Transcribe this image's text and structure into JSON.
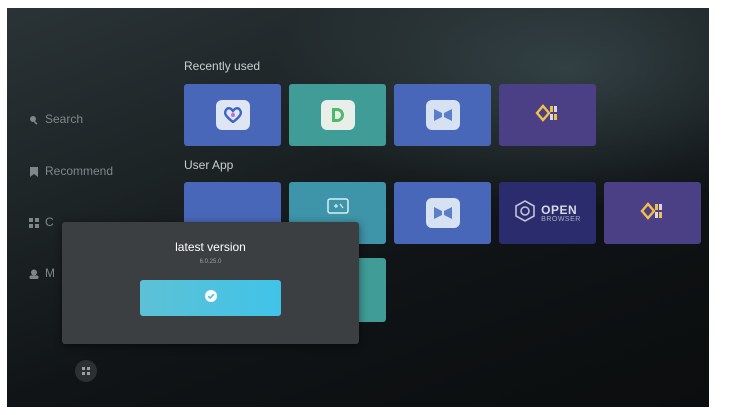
{
  "sidebar": {
    "items": [
      {
        "label": "Search",
        "icon": "search-icon"
      },
      {
        "label": "Recommend",
        "icon": "bookmark-icon"
      },
      {
        "label": "C",
        "icon": "grid-icon"
      },
      {
        "label": "M",
        "icon": "person-icon"
      }
    ]
  },
  "sections": {
    "recent_title": "Recently used",
    "user_title": "User App"
  },
  "recent_apps": [
    {
      "icon": "heart-link-icon",
      "color": "#4967b8"
    },
    {
      "icon": "green-d-icon",
      "color": "#3f9c97"
    },
    {
      "icon": "butterfly-icon",
      "color": "#4967b8"
    },
    {
      "icon": "gem-logo-icon",
      "color": "#4b3f86"
    }
  ],
  "user_apps": [
    {
      "icon": "blank-icon",
      "color": "#4967b8"
    },
    {
      "icon": "calculator-icon",
      "color": "#3e94a8"
    },
    {
      "icon": "butterfly-icon",
      "color": "#4967b8"
    },
    {
      "icon": "open-browser-icon",
      "color": "#2b2c6e",
      "big": "OPEN",
      "small": "BROWSER"
    },
    {
      "icon": "gem-logo-icon",
      "color": "#4b3f86"
    }
  ],
  "modal": {
    "title": "latest version",
    "version": "6.0.25.0",
    "confirm_icon": "check-circle-icon"
  },
  "footer": {
    "apps_icon": "apps-grid-icon"
  }
}
